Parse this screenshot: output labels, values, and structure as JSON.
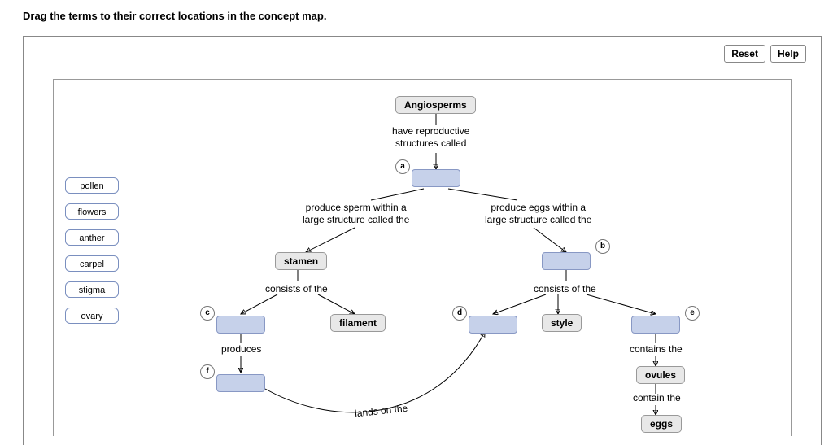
{
  "instruction": "Drag the terms to their correct locations in the concept map.",
  "buttons": {
    "reset": "Reset",
    "help": "Help"
  },
  "terms": [
    "pollen",
    "flowers",
    "anther",
    "carpel",
    "stigma",
    "ovary"
  ],
  "nodes": {
    "root": "Angiosperms",
    "stamen": "stamen",
    "filament": "filament",
    "style": "style",
    "ovules": "ovules",
    "eggs": "eggs"
  },
  "links": {
    "l1": "have reproductive\nstructures called",
    "l2": "produce sperm within a\nlarge structure called the",
    "l3": "produce eggs within a\nlarge structure called the",
    "l4a": "consists of the",
    "l4b": "consists of the",
    "l5": "produces",
    "l6": "lands on the",
    "l7": "contains the",
    "l8": "contain the"
  },
  "markers": {
    "a": "a",
    "b": "b",
    "c": "c",
    "d": "d",
    "e": "e",
    "f": "f"
  }
}
